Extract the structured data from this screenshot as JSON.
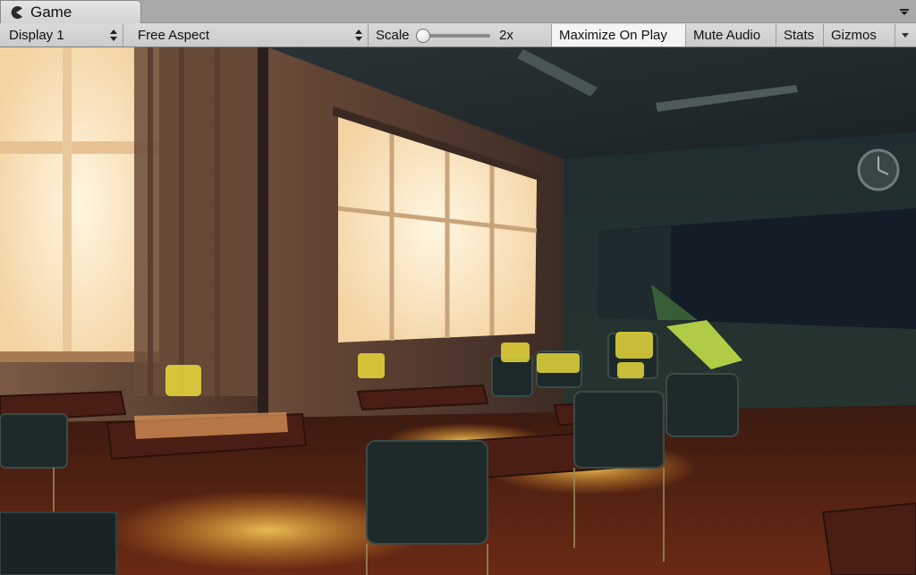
{
  "tab": {
    "title": "Game",
    "icon": "pacman-icon"
  },
  "window": {
    "menu_icon": "panel-menu-icon"
  },
  "toolbar": {
    "display": {
      "label": "Display 1"
    },
    "aspect": {
      "label": "Free Aspect"
    },
    "scale": {
      "label": "Scale",
      "value_label": "2x",
      "level": 0.0
    },
    "maximize_on_play": {
      "label": "Maximize On Play",
      "active": true
    },
    "mute_audio": {
      "label": "Mute Audio"
    },
    "stats": {
      "label": "Stats"
    },
    "gizmos": {
      "label": "Gizmos"
    }
  },
  "scene": {
    "description_type": "rendered-3d-game-view",
    "colors": {
      "window_glow": "#fff2d6",
      "floor": "#5a2312",
      "shadow": "#14191c",
      "chair_light": "#f2e23a"
    }
  }
}
